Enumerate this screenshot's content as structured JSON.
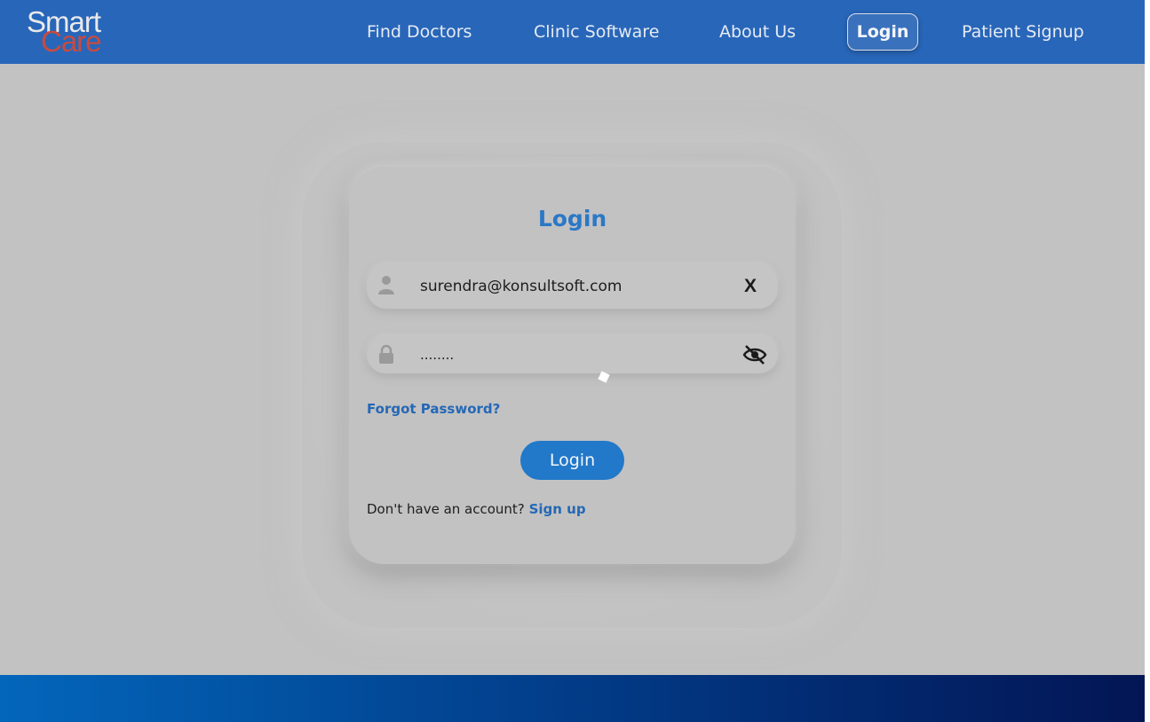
{
  "header": {
    "logo": {
      "line1": "Smart",
      "line2": "Care"
    },
    "nav": [
      {
        "label": "Find Doctors"
      },
      {
        "label": "Clinic Software"
      },
      {
        "label": "About Us"
      },
      {
        "label": "Login"
      },
      {
        "label": "Patient Signup"
      }
    ]
  },
  "login_form": {
    "title": "Login",
    "email": {
      "value": "surendra@konsultsoft.com",
      "icon": "user-icon",
      "clear_label": "X"
    },
    "password": {
      "value": "........",
      "icon": "lock-icon",
      "toggle_icon": "eye-slash-icon"
    },
    "forgot_label": "Forgot Password?",
    "submit_label": "Login",
    "signup_prompt": "Don't have an account?",
    "signup_link": "Sign up"
  },
  "colors": {
    "header_bg": "#2866b9",
    "accent": "#2278c9",
    "logo_smart": "#e9e9e9",
    "logo_care": "#c84b3e",
    "background": "#c2c2c2"
  }
}
